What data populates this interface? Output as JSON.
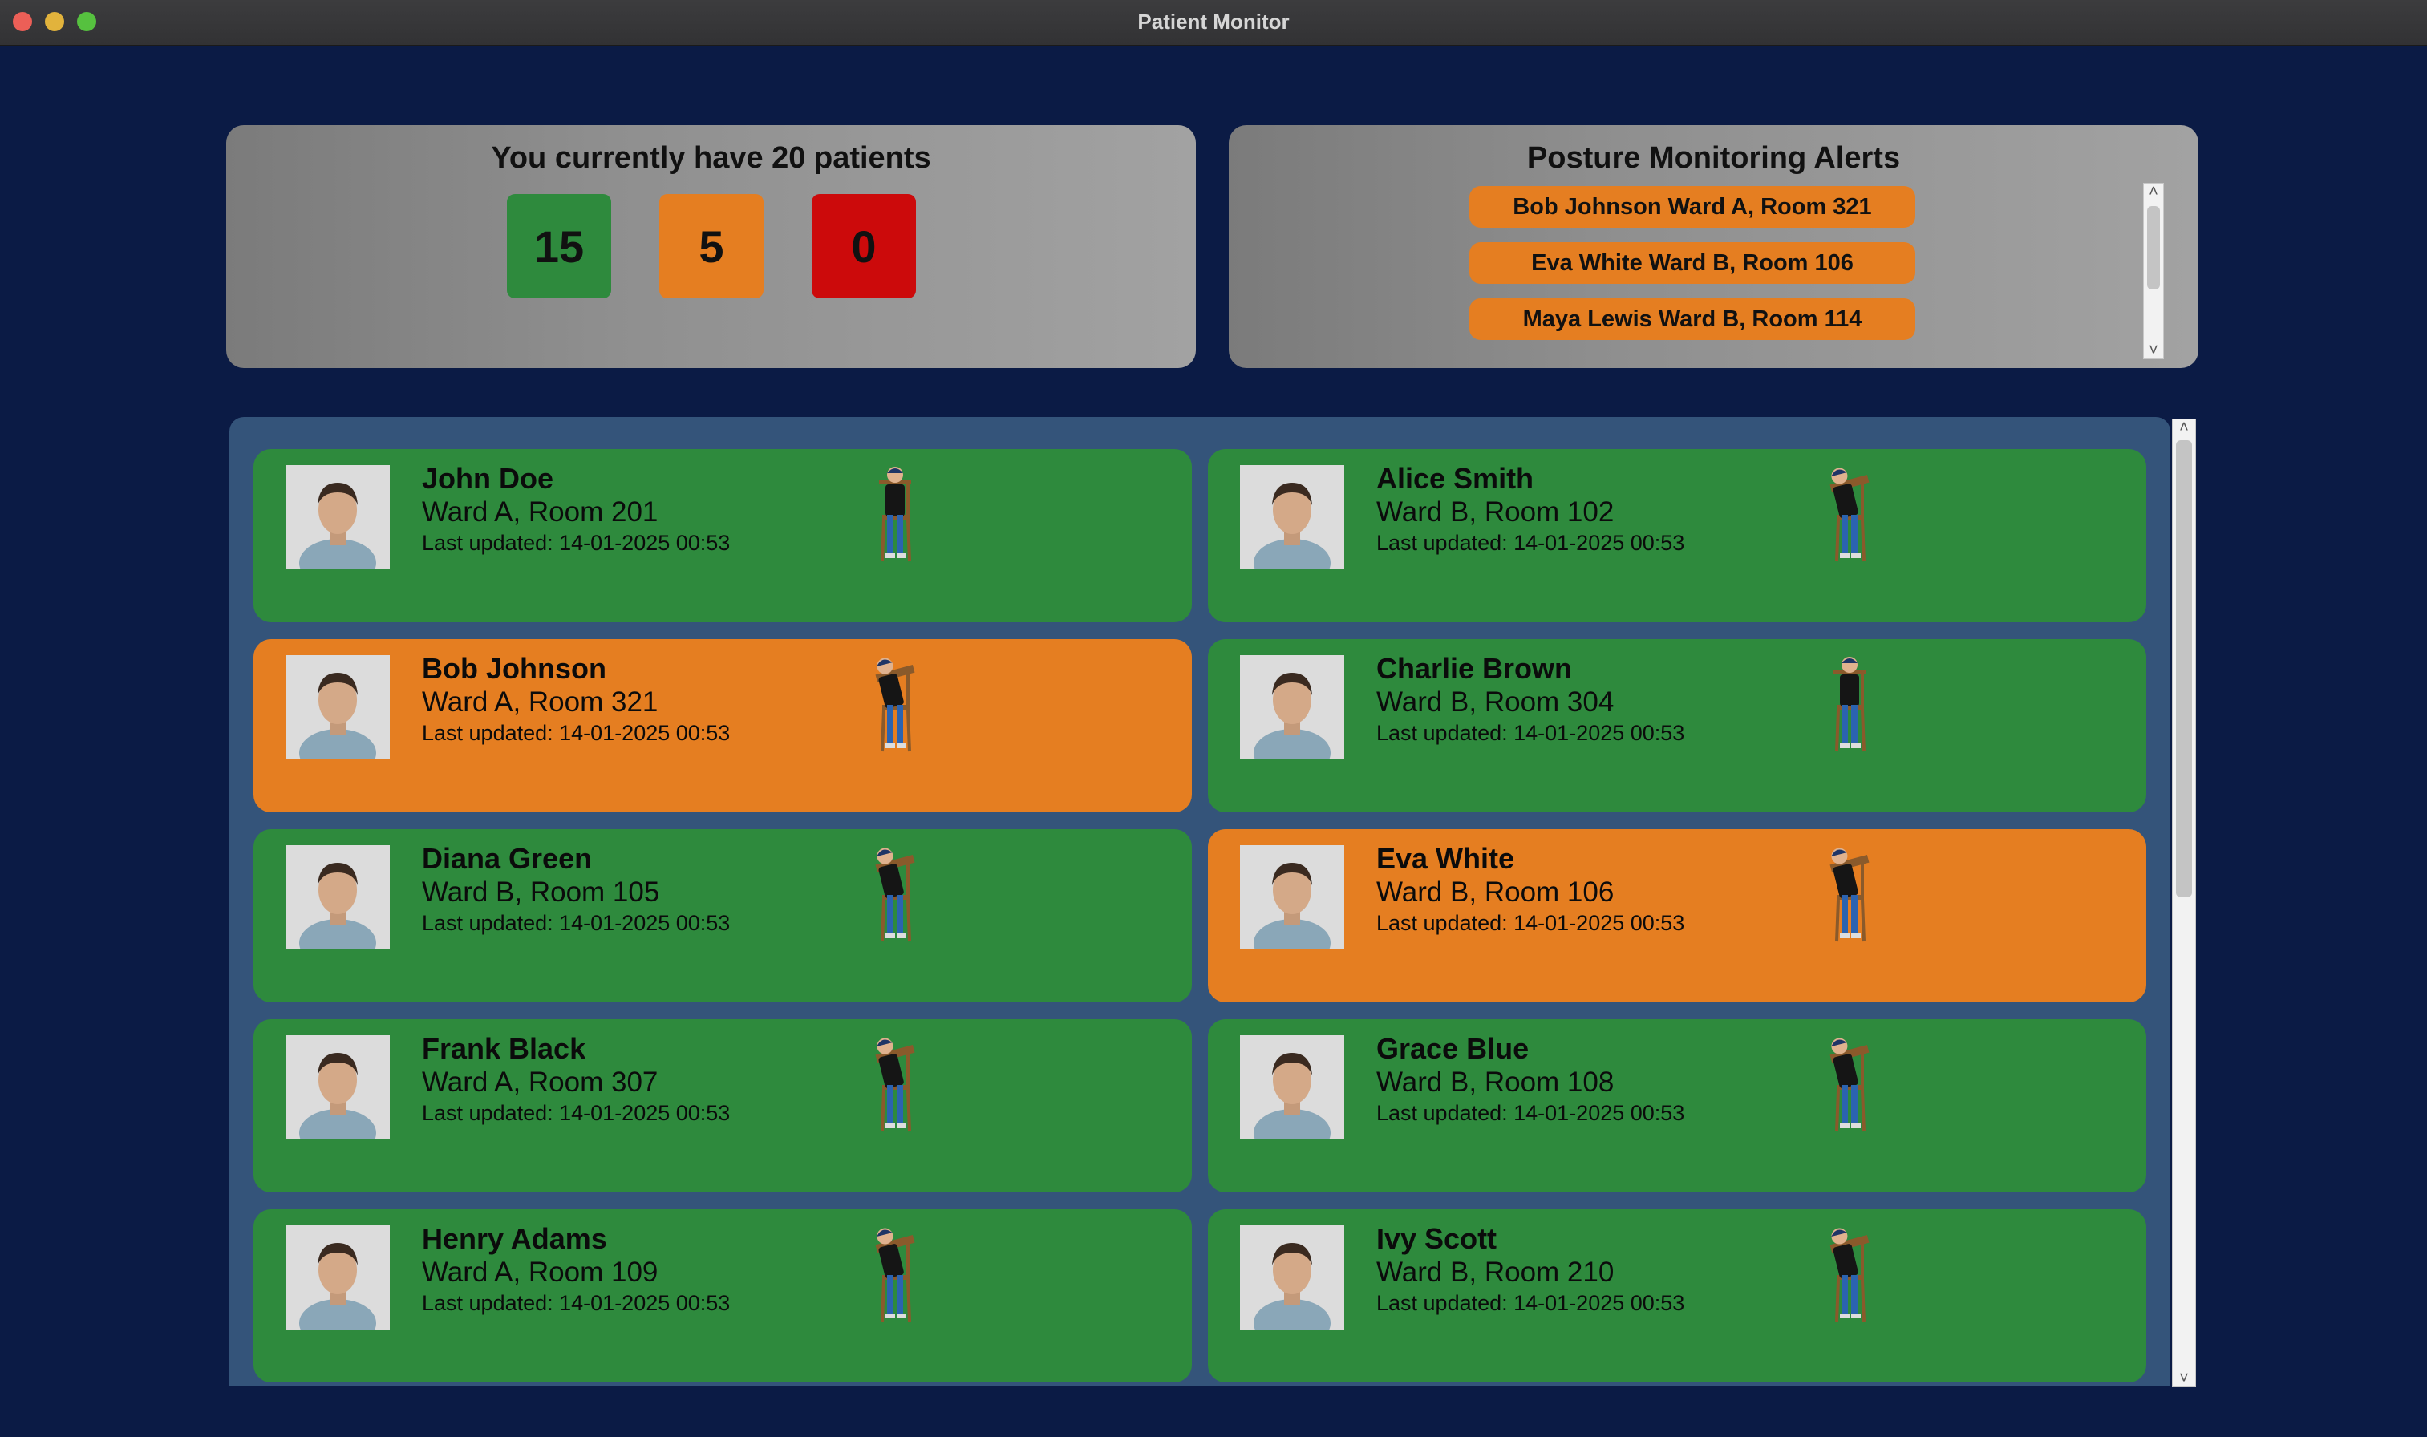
{
  "window": {
    "title": "Patient Monitor"
  },
  "summary": {
    "title": "You currently have 20 patients",
    "counts": [
      {
        "value": "15",
        "status": "normal",
        "color": "#2e8a3d"
      },
      {
        "value": "5",
        "status": "warning",
        "color": "#e57e21"
      },
      {
        "value": "0",
        "status": "critical",
        "color": "#cc0a0b"
      }
    ]
  },
  "alerts": {
    "title": "Posture Monitoring Alerts",
    "items": [
      "Bob Johnson Ward A, Room 321",
      "Eva White Ward B, Room 106",
      "Maya Lewis Ward B, Room 114",
      ""
    ]
  },
  "patients": [
    {
      "name": "John Doe",
      "ward": "Ward A, Room 201",
      "updated": "Last updated: 14-01-2025 00:53",
      "status": "green",
      "posture": "upright"
    },
    {
      "name": "Alice Smith",
      "ward": "Ward B, Room 102",
      "updated": "Last updated: 14-01-2025 00:53",
      "status": "green",
      "posture": "leaning"
    },
    {
      "name": "Bob Johnson",
      "ward": "Ward A, Room 321",
      "updated": "Last updated: 14-01-2025 00:53",
      "status": "orange",
      "posture": "leaning"
    },
    {
      "name": "Charlie Brown",
      "ward": "Ward B, Room 304",
      "updated": "Last updated: 14-01-2025 00:53",
      "status": "green",
      "posture": "upright"
    },
    {
      "name": "Diana Green",
      "ward": "Ward B, Room 105",
      "updated": "Last updated: 14-01-2025 00:53",
      "status": "green",
      "posture": "leaning"
    },
    {
      "name": "Eva White",
      "ward": "Ward B, Room 106",
      "updated": "Last updated: 14-01-2025 00:53",
      "status": "orange",
      "posture": "leaning"
    },
    {
      "name": "Frank Black",
      "ward": "Ward A, Room 307",
      "updated": "Last updated: 14-01-2025 00:53",
      "status": "green",
      "posture": "leaning"
    },
    {
      "name": "Grace Blue",
      "ward": "Ward B, Room 108",
      "updated": "Last updated: 14-01-2025 00:53",
      "status": "green",
      "posture": "leaning"
    },
    {
      "name": "Henry Adams",
      "ward": "Ward A, Room 109",
      "updated": "Last updated: 14-01-2025 00:53",
      "status": "green",
      "posture": "leaning"
    },
    {
      "name": "Ivy Scott",
      "ward": "Ward B, Room 210",
      "updated": "Last updated: 14-01-2025 00:53",
      "status": "green",
      "posture": "leaning"
    }
  ],
  "colors": {
    "background": "#0b1b45",
    "list_bg": "#34547a",
    "ok": "#2e8a3d",
    "warn": "#e57e21",
    "crit": "#cc0a0b"
  }
}
